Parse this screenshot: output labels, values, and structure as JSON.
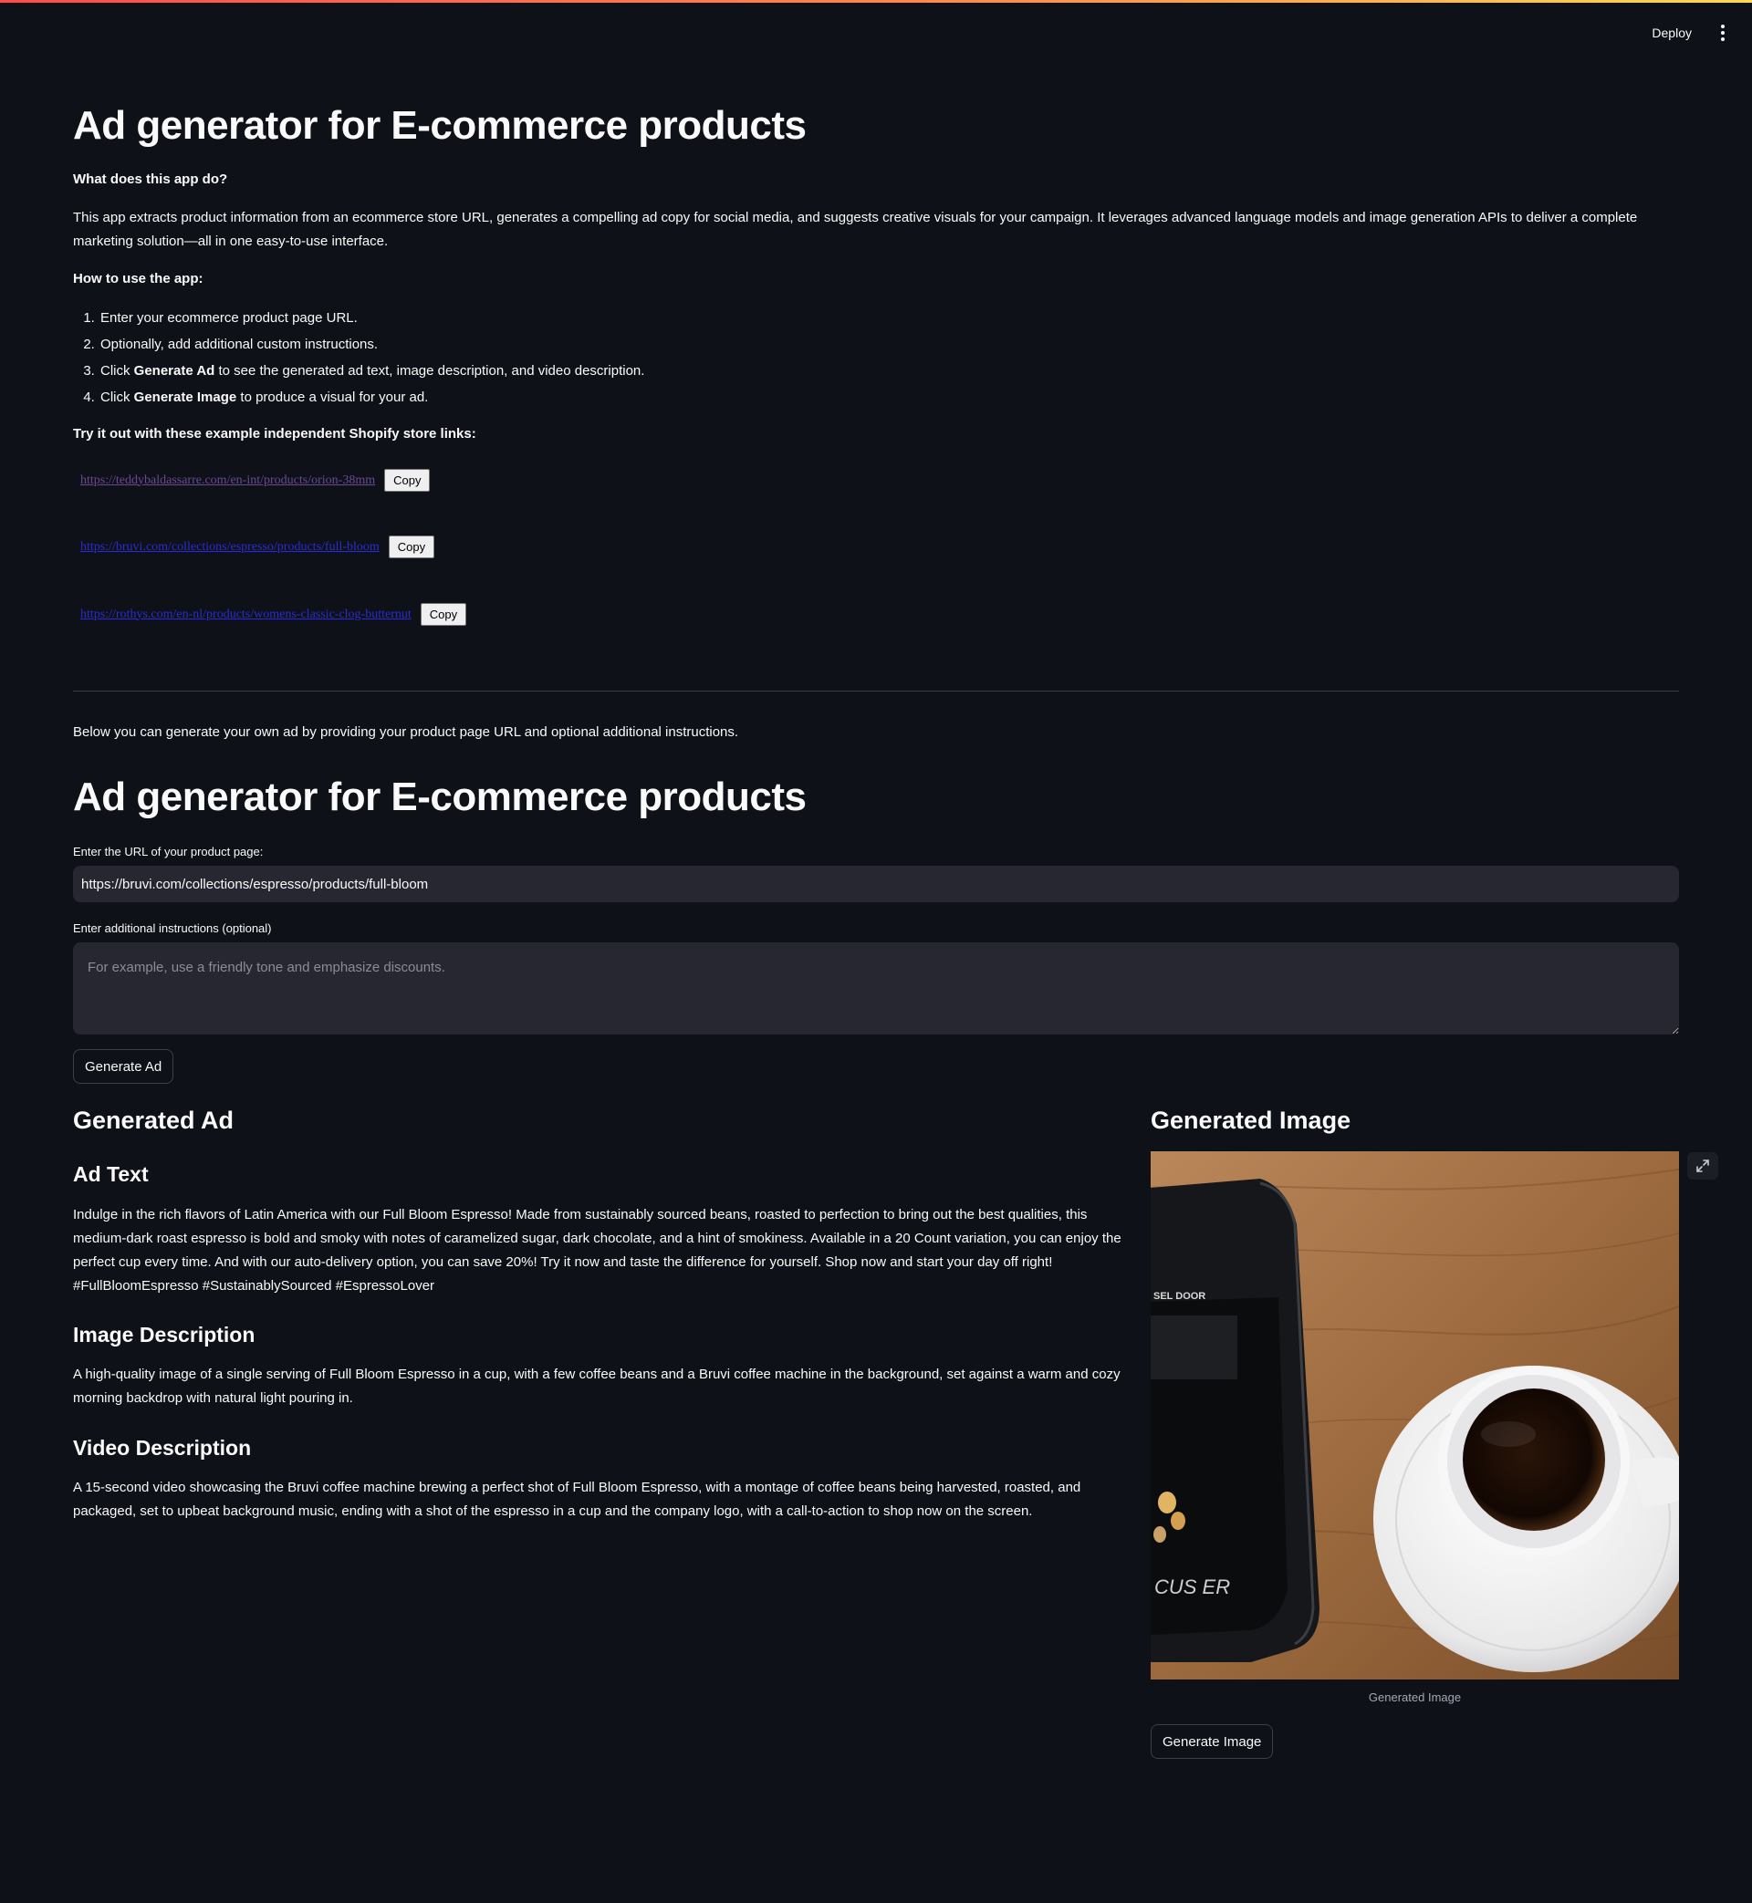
{
  "header": {
    "deploy_label": "Deploy",
    "menu_icon": "kebab-menu-icon"
  },
  "intro": {
    "title": "Ad generator for E-commerce products",
    "what_heading": "What does this app do?",
    "what_text": "This app extracts product information from an ecommerce store URL, generates a compelling ad copy for social media, and suggests creative visuals for your campaign. It leverages advanced language models and image generation APIs to deliver a complete marketing solution—all in one easy-to-use interface.",
    "howto_heading": "How to use the app:",
    "steps": [
      {
        "pre": "Enter your ecommerce product page URL.",
        "bold": "",
        "post": ""
      },
      {
        "pre": "Optionally, add additional custom instructions.",
        "bold": "",
        "post": ""
      },
      {
        "pre": "Click ",
        "bold": "Generate Ad",
        "post": " to see the generated ad text, image description, and video description."
      },
      {
        "pre": "Click ",
        "bold": "Generate Image",
        "post": " to produce a visual for your ad."
      }
    ],
    "examples_heading": "Try it out with these example independent Shopify store links:",
    "links": [
      {
        "url": "https://teddybaldassarre.com/en-int/products/orion-38mm",
        "copy_label": "Copy",
        "visited": true
      },
      {
        "url": "https://bruvi.com/collections/espresso/products/full-bloom",
        "copy_label": "Copy",
        "visited": false
      },
      {
        "url": "https://rothys.com/en-nl/products/womens-classic-clog-butternut",
        "copy_label": "Copy",
        "visited": false
      }
    ],
    "below_text": "Below you can generate your own ad by providing your product page URL and optional additional instructions."
  },
  "form": {
    "title": "Ad generator for E-commerce products",
    "url_label": "Enter the URL of your product page:",
    "url_value": "https://bruvi.com/collections/espresso/products/full-bloom",
    "instructions_label": "Enter additional instructions (optional)",
    "instructions_value": "",
    "instructions_placeholder": "For example, use a friendly tone and emphasize discounts.",
    "generate_ad_label": "Generate Ad"
  },
  "result": {
    "ad_heading": "Generated Ad",
    "ad_text_heading": "Ad Text",
    "ad_text": "Indulge in the rich flavors of Latin America with our Full Bloom Espresso! Made from sustainably sourced beans, roasted to perfection to bring out the best qualities, this medium-dark roast espresso is bold and smoky with notes of caramelized sugar, dark chocolate, and a hint of smokiness. Available in a 20 Count variation, you can enjoy the perfect cup every time. And with our auto-delivery option, you can save 20%! Try it now and taste the difference for yourself. Shop now and start your day off right! #FullBloomEspresso #SustainablySourced #EspressoLover",
    "image_desc_heading": "Image Description",
    "image_desc": "A high-quality image of a single serving of Full Bloom Espresso in a cup, with a few coffee beans and a Bruvi coffee machine in the background, set against a warm and cozy morning backdrop with natural light pouring in.",
    "video_desc_heading": "Video Description",
    "video_desc": "A 15-second video showcasing the Bruvi coffee machine brewing a perfect shot of Full Bloom Espresso, with a montage of coffee beans being harvested, roasted, and packaged, set to upbeat background music, ending with a shot of the espresso in a cup and the company logo, with a call-to-action to shop now on the screen.",
    "image_heading": "Generated Image",
    "image_caption": "Generated Image",
    "machine_label_top": "SEL DOOR",
    "machine_label_bottom": "CUS ER",
    "expand_icon": "fullscreen-expand-icon",
    "generate_image_label": "Generate Image"
  },
  "colors": {
    "background": "#0e1117",
    "input_bg": "#262730",
    "text": "#fafafa",
    "visited_link": "#6a4a96",
    "link": "#2b2bd8"
  }
}
